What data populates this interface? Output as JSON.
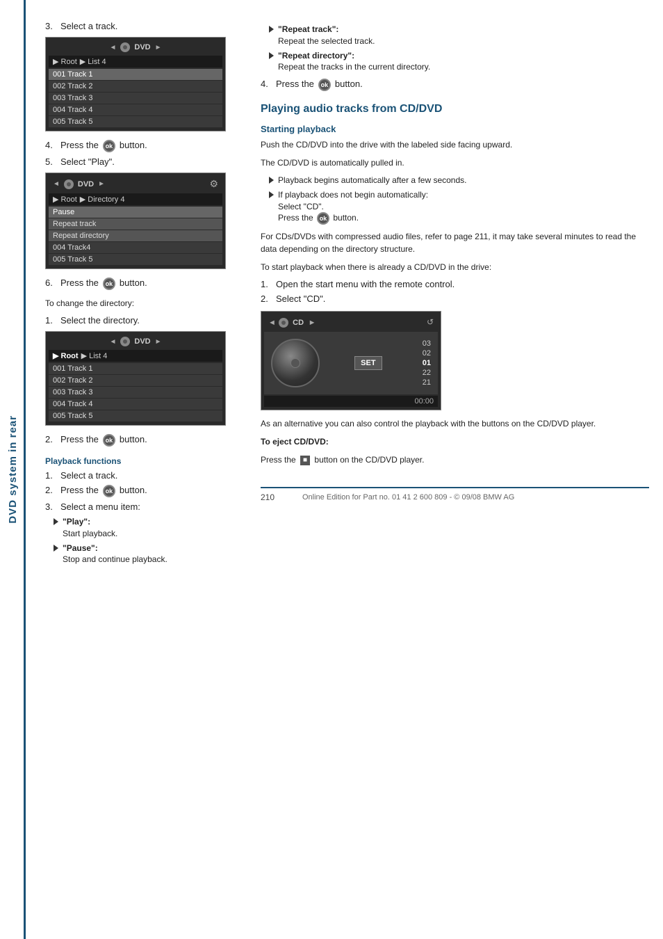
{
  "sidebar": {
    "label": "DVD system in rear"
  },
  "left_col": {
    "step3": {
      "num": "3.",
      "text": "Select a track."
    },
    "screen1": {
      "header_left": "◄ ● DVD ►",
      "breadcrumb": [
        "▶ Root",
        "▶ List 4"
      ],
      "rows": [
        {
          "text": "001 Track 1",
          "selected": true
        },
        {
          "text": "002 Track 2",
          "selected": false
        },
        {
          "text": "003 Track 3",
          "selected": false
        },
        {
          "text": "004 Track 4",
          "selected": false
        },
        {
          "text": "005 Track 5",
          "selected": false
        }
      ]
    },
    "step4": {
      "num": "4.",
      "text": "Press the"
    },
    "ok_label": "ok",
    "step4_suffix": "button.",
    "step5": {
      "num": "5.",
      "text": "Select \"Play\"."
    },
    "screen2": {
      "header_left": "◄ ● DVD ►",
      "breadcrumb": [
        "▶ Root",
        "▶ Directory 4"
      ],
      "rows": [
        {
          "text": "Pause",
          "selected": true
        },
        {
          "text": "Repeat track",
          "selected": false
        },
        {
          "text": "Repeat directory",
          "selected": false
        },
        {
          "text": "004 Track4",
          "selected": false
        },
        {
          "text": "005 Track 5",
          "selected": false
        }
      ]
    },
    "step6": {
      "num": "6.",
      "text": "Press the"
    },
    "step6_suffix": "button.",
    "dir_change": "To change the directory:",
    "step_dir1": {
      "num": "1.",
      "text": "Select the directory."
    },
    "screen3": {
      "header_left": "◄ ● DVD ►",
      "breadcrumb": [
        "▶ Root",
        "▶ List 4"
      ],
      "rows": [
        {
          "text": "001 Track 1",
          "selected": false
        },
        {
          "text": "002 Track 2",
          "selected": false
        },
        {
          "text": "003 Track 3",
          "selected": false
        },
        {
          "text": "004 Track 4",
          "selected": false
        },
        {
          "text": "005 Track 5",
          "selected": false
        }
      ]
    },
    "step_dir2": {
      "num": "2.",
      "text": "Press the"
    },
    "step_dir2_suffix": "button.",
    "playback_heading": "Playback functions",
    "pb_step1": {
      "num": "1.",
      "text": "Select a track."
    },
    "pb_step2": {
      "num": "2.",
      "text": "Press the"
    },
    "pb_step2_suffix": "button.",
    "pb_step3": {
      "num": "3.",
      "text": "Select a menu item:"
    },
    "pb_bullets": [
      {
        "label": "\"Play\":",
        "desc": "Start playback."
      },
      {
        "label": "\"Pause\":",
        "desc": "Stop and continue playback."
      }
    ]
  },
  "right_col": {
    "right_bullets": [
      {
        "label": "\"Repeat track\":",
        "desc": "Repeat the selected track."
      },
      {
        "label": "\"Repeat directory\":",
        "desc": "Repeat the tracks in the current directory."
      }
    ],
    "step4": {
      "num": "4.",
      "text": "Press the"
    },
    "step4_suffix": "button.",
    "section_title": "Playing audio tracks from CD/DVD",
    "subsection_title": "Starting playback",
    "para1": "Push the CD/DVD into the drive with the labeled side facing upward.",
    "para2": "The CD/DVD is automatically pulled in.",
    "bullets": [
      {
        "text": "Playback begins automatically after a few seconds."
      },
      {
        "text": "If playback does not begin automatically: Select \"CD\"."
      }
    ],
    "press_ok": "Press the",
    "press_ok_suffix": "button.",
    "para3": "For CDs/DVDs with compressed audio files, refer to page 211, it may take several minutes to read the data depending on the directory structure.",
    "para4": "To start playback when there is already a CD/DVD in the drive:",
    "step_cd1": {
      "num": "1.",
      "text": "Open the start menu with the remote control."
    },
    "step_cd2": {
      "num": "2.",
      "text": "Select \"CD\"."
    },
    "cd_screen": {
      "header_left": "◄ ● CD ►",
      "tracks": [
        "03",
        "02",
        "01",
        "22",
        "21"
      ],
      "active_track": "01",
      "time": "00:00"
    },
    "para5": "As an alternative you can also control the playback with the buttons on the CD/DVD player.",
    "eject_label": "To eject CD/DVD:",
    "eject_text": "Press the",
    "eject_icon": "■",
    "eject_suffix": "button on the CD/DVD player."
  },
  "footer": {
    "page_num": "210",
    "footer_text": "Online Edition for Part no. 01 41 2 600 809 - © 09/08 BMW AG"
  }
}
